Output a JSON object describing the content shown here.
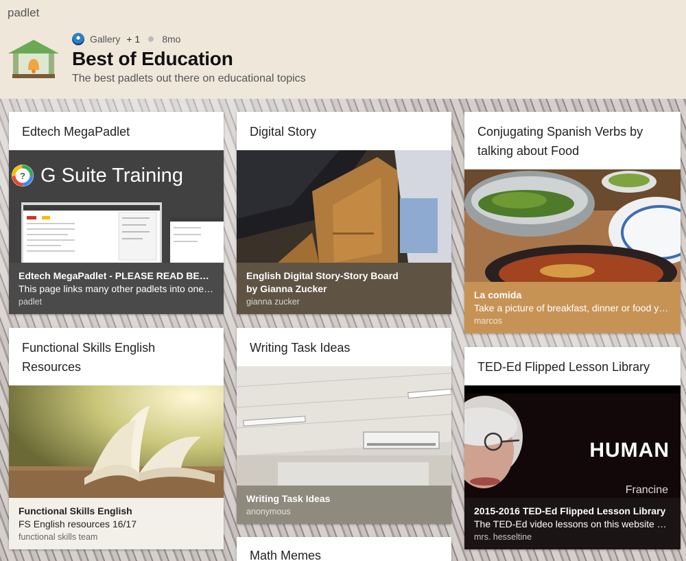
{
  "app": {
    "logo": "padlet"
  },
  "header": {
    "gallery_label": "Gallery",
    "plus_count": "+ 1",
    "age": "8mo",
    "title": "Best of Education",
    "subtitle": "The best padlets out there on educational topics"
  },
  "cards": [
    {
      "title": "Edtech MegaPadlet",
      "thumb_text": "G Suite Training",
      "line1": "Edtech MegaPadlet - PLEASE READ BELOW",
      "line2": "This page links many other padlets into one place",
      "author": "padlet"
    },
    {
      "title": "Digital Story",
      "line1": "English Digital Story-Story Board",
      "line2": "by Gianna Zucker",
      "author": "gianna zucker"
    },
    {
      "title": "Conjugating Spanish Verbs by talking about Food",
      "line1": "La comida",
      "line2": "Take a picture of breakfast, dinner or food you like",
      "author": "marcos"
    },
    {
      "title": "Functional Skills English Resources",
      "line1": "Functional Skills English",
      "line2": "FS English resources 16/17",
      "author": "functional skills team"
    },
    {
      "title": "Writing Task Ideas",
      "line1": "Writing Task Ideas",
      "author": "anonymous"
    },
    {
      "title": "TED-Ed Flipped Lesson Library",
      "thumb_text": "HUMAN",
      "thumb_subtext": "Francine",
      "line1": "2015-2016 TED-Ed Flipped Lesson Library",
      "line2": "The TED-Ed video lessons on this website are great",
      "author": "mrs. hesseltine"
    },
    {
      "title": "Math Memes"
    }
  ],
  "colors": {
    "header_bg": "#efe7da",
    "info_dark_gray": "#4a4a4a",
    "info_brown": "#5f5444",
    "info_tan": "#c79355",
    "info_cream": "#f3f0ea",
    "info_taupe": "#8e8a7e",
    "info_black": "#1a1414"
  }
}
